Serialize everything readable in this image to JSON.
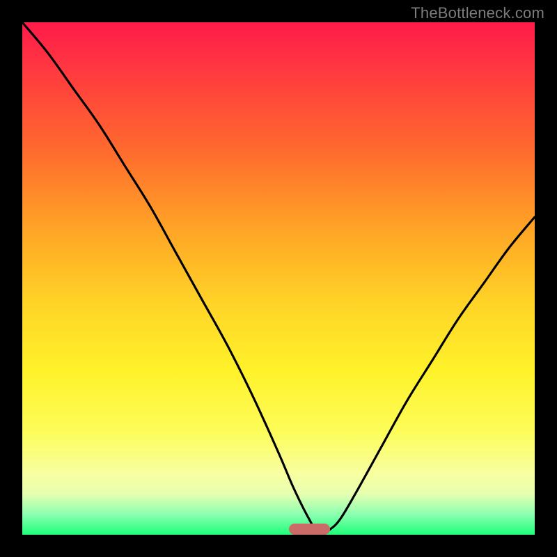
{
  "watermark": "TheBottleneck.com",
  "colors": {
    "frame": "#000000",
    "gradient_top": "#ff1a4a",
    "gradient_bottom": "#1eff7a",
    "curve": "#000000",
    "marker": "#cb6b68",
    "watermark": "#7d7d7d"
  },
  "marker": {
    "x_pct": 56,
    "width_pct": 8
  },
  "chart_data": {
    "type": "line",
    "title": "",
    "xlabel": "",
    "ylabel": "",
    "xlim": [
      0,
      100
    ],
    "ylim": [
      0,
      100
    ],
    "notes": "Background heat gradient from red (high bottleneck) at top to green (no bottleneck) at bottom. Black V-shaped curve; minimum (optimal point) near x≈58. Salmon pill marker on x-axis at the optimal range.",
    "series": [
      {
        "name": "bottleneck-curve",
        "x": [
          0,
          5,
          10,
          15,
          20,
          25,
          30,
          35,
          40,
          45,
          50,
          53,
          56,
          58,
          60,
          62,
          65,
          70,
          75,
          80,
          85,
          90,
          95,
          100
        ],
        "values": [
          100,
          94,
          87,
          80,
          72,
          64,
          55,
          46,
          37,
          27,
          16,
          9,
          3,
          0,
          1,
          3,
          8,
          17,
          26,
          34,
          42,
          49,
          56,
          62
        ]
      }
    ],
    "optimal_x": 58,
    "optimal_range_x": [
      54,
      62
    ]
  }
}
